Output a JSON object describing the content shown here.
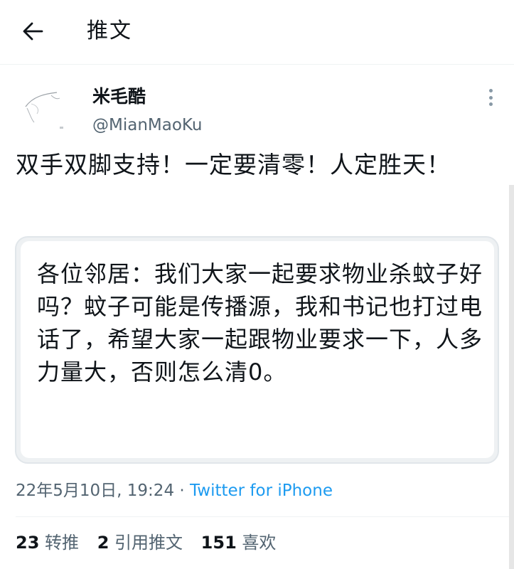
{
  "header": {
    "back_icon": "arrow-left-icon",
    "title": "推文"
  },
  "tweet": {
    "author": {
      "display_name": "米毛酷",
      "handle": "@MianMaoKu"
    },
    "more_icon": "more-vertical-icon",
    "text": "双手双脚支持！一定要清零！人定胜天！",
    "embedded_image_text": "各位邻居：我们大家一起要求物业杀蚊子好吗？蚊子可能是传播源，我和书记也打过电话了，希望大家一起跟物业要求一下，人多力量大，否则怎么清0。",
    "timestamp": "22年5月10日, 19:24",
    "separator": " · ",
    "source": "Twitter for iPhone"
  },
  "stats": {
    "retweets_count": "23",
    "retweets_label": "转推",
    "quotes_count": "2",
    "quotes_label": "引用推文",
    "likes_count": "151",
    "likes_label": "喜欢"
  },
  "colors": {
    "text_primary": "#0f1419",
    "text_secondary": "#536471",
    "link_blue": "#1d9bf0",
    "divider": "#eff3f4"
  }
}
